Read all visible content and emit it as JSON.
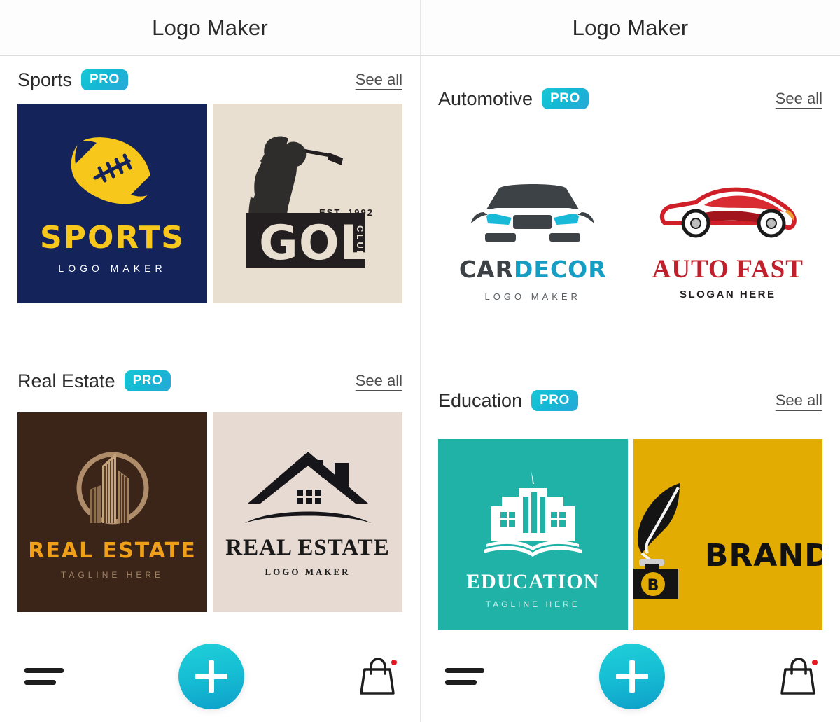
{
  "app": {
    "title": "Logo Maker",
    "accent_teal": "#17c8d6",
    "accent_orange": "#f79521",
    "badge_label": "PRO",
    "see_all_label": "See all"
  },
  "panels": [
    {
      "id": "left",
      "title": "Logo Maker",
      "sections": [
        {
          "name": "Sports",
          "badge": "PRO",
          "see_all": "See all",
          "cards": [
            {
              "id": "sports-logo",
              "style": "c-sports",
              "icon": "football-icon",
              "title": "SPORTS",
              "subtitle": "LOGO MAKER",
              "bg": "#15235b"
            },
            {
              "id": "golf-logo",
              "style": "c-golf",
              "icon": "golfer-silhouette-icon",
              "est": "EST. 1992",
              "title": "GOLF",
              "vertical": "CLUB",
              "bg": "#e8dfd1"
            }
          ]
        },
        {
          "name": "Real Estate",
          "badge": "PRO",
          "see_all": "See all",
          "cards": [
            {
              "id": "real-estate-dark-logo",
              "style": "c-re-dark",
              "icon": "skyline-circle-icon",
              "title": "REAL ESTATE",
              "subtitle": "TAGLINE HERE",
              "bg": "#3b2418"
            },
            {
              "id": "real-estate-light-logo",
              "style": "c-re-light",
              "icon": "house-roof-icon",
              "title": "REAL ESTATE",
              "subtitle": "LOGO MAKER",
              "bg": "#e6dad2"
            }
          ]
        }
      ]
    },
    {
      "id": "right",
      "title": "Logo Maker",
      "sections": [
        {
          "name": "Automotive",
          "badge": "PRO",
          "see_all": "See all",
          "cards": [
            {
              "id": "car-decor-logo",
              "style": "c-white",
              "icon": "car-front-icon",
              "title_a": "CAR",
              "title_b": "DECOR",
              "subtitle": "LOGO MAKER",
              "bg": "#ffffff"
            },
            {
              "id": "auto-fast-logo",
              "style": "c-white",
              "icon": "sports-car-side-icon",
              "title": "AUTO FAST",
              "subtitle": "SLOGAN HERE",
              "bg": "#ffffff"
            }
          ]
        },
        {
          "name": "Education",
          "badge": "PRO",
          "see_all": "See all",
          "cards": [
            {
              "id": "education-logo",
              "style": "c-edu",
              "icon": "school-book-icon",
              "title": "EDUCATION",
              "subtitle": "TAGLINE HERE",
              "bg": "#20b2a6"
            },
            {
              "id": "brand-logo",
              "style": "c-brand",
              "icon": "quill-inkwell-icon",
              "monogram": "B",
              "title": "BRAND",
              "bg": "#e2ac03"
            }
          ]
        }
      ]
    }
  ],
  "bottom_nav": {
    "menu_label": "menu-icon",
    "create_label": "+",
    "shop_label": "shop-bag-icon",
    "badge_visible": true
  }
}
